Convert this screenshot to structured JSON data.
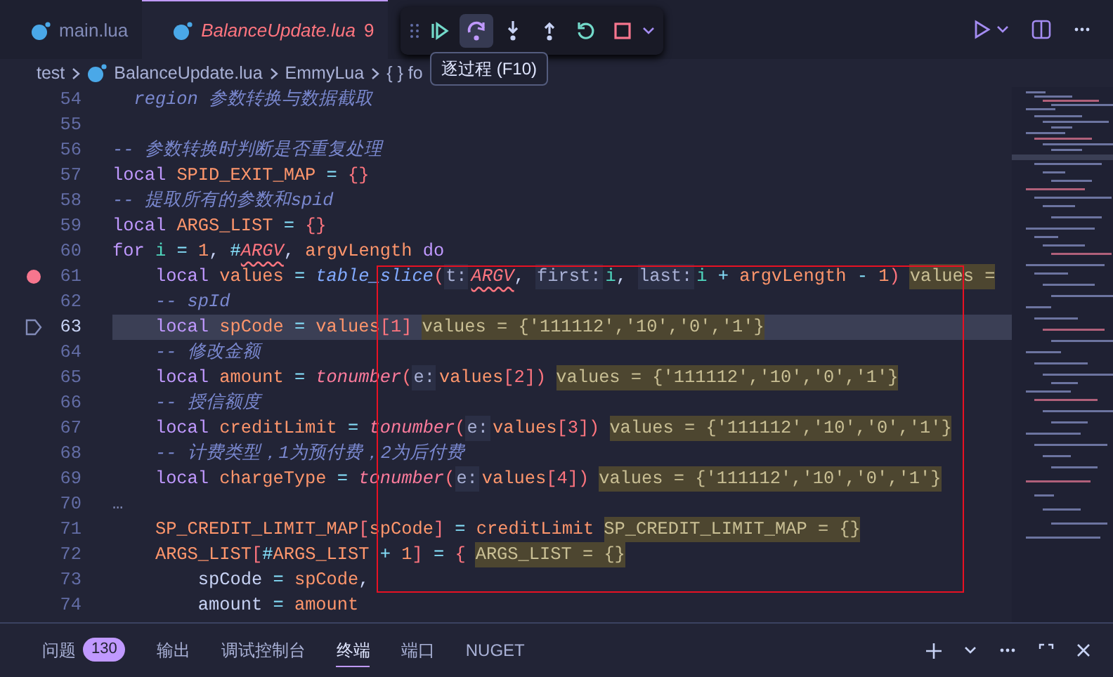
{
  "tabs": [
    {
      "label": "main.lua",
      "selected": false
    },
    {
      "label": "BalanceUpdate.lua",
      "selected": true,
      "problems": "9"
    }
  ],
  "debug_toolbar": {
    "buttons": [
      {
        "kind": "continue",
        "active": false
      },
      {
        "kind": "step-over",
        "active": true
      },
      {
        "kind": "step-into",
        "active": false
      },
      {
        "kind": "step-out",
        "active": false
      },
      {
        "kind": "restart",
        "active": false
      },
      {
        "kind": "stop",
        "active": false
      }
    ],
    "tooltip": "逐过程 (F10)"
  },
  "breadcrumb": [
    "test",
    "BalanceUpdate.lua",
    "EmmyLua",
    "{ } fo"
  ],
  "editor": {
    "lines": [
      {
        "number": "54",
        "breakpoint": false,
        "current": false,
        "tokens": [
          {
            "kind": "comment",
            "text": "  region 参数转换与数据截取"
          }
        ]
      },
      {
        "number": "55",
        "breakpoint": false,
        "current": false
      },
      {
        "number": "56",
        "breakpoint": false,
        "current": false,
        "tokens": [
          {
            "kind": "comment",
            "text": "-- 参数转换时判断是否重复处理"
          }
        ]
      },
      {
        "number": "57",
        "breakpoint": false,
        "current": false,
        "tokens": [
          {
            "kind": "kw",
            "text": "local "
          },
          {
            "kind": "var",
            "text": "SPID_EXIT_MAP "
          },
          {
            "kind": "op",
            "text": "= "
          },
          {
            "kind": "br",
            "text": "{}"
          }
        ]
      },
      {
        "number": "58",
        "breakpoint": false,
        "current": false,
        "tokens": [
          {
            "kind": "comment",
            "text": "-- 提取所有的参数和spid"
          }
        ]
      },
      {
        "number": "59",
        "breakpoint": false,
        "current": false,
        "tokens": [
          {
            "kind": "kw",
            "text": "local "
          },
          {
            "kind": "var",
            "text": "ARGS_LIST "
          },
          {
            "kind": "op",
            "text": "= "
          },
          {
            "kind": "br",
            "text": "{}"
          }
        ]
      },
      {
        "number": "60",
        "breakpoint": false,
        "current": false,
        "tokens": [
          {
            "kind": "kw",
            "text": "for "
          },
          {
            "kind": "loop",
            "text": "i "
          },
          {
            "kind": "op",
            "text": "= "
          },
          {
            "kind": "num",
            "text": "1"
          },
          {
            "kind": "plain",
            "text": ", "
          },
          {
            "kind": "op",
            "text": "#"
          },
          {
            "kind": "err",
            "text": "ARGV"
          },
          {
            "kind": "plain",
            "text": ", "
          },
          {
            "kind": "var",
            "text": "argvLength "
          },
          {
            "kind": "kw",
            "text": "do"
          }
        ]
      },
      {
        "number": "61",
        "breakpoint": true,
        "current": false,
        "tokens": [
          {
            "kind": "kw",
            "text": "    local "
          },
          {
            "kind": "var",
            "text": "values "
          },
          {
            "kind": "op",
            "text": "= "
          },
          {
            "kind": "fn",
            "text": "table_slice"
          },
          {
            "kind": "br",
            "text": "("
          },
          {
            "kind": "param",
            "text": "t:"
          },
          {
            "kind": "err",
            "text": "ARGV"
          },
          {
            "kind": "plain",
            "text": ", "
          },
          {
            "kind": "param",
            "text": "first:"
          },
          {
            "kind": "loop",
            "text": "i"
          },
          {
            "kind": "plain",
            "text": ", "
          },
          {
            "kind": "param",
            "text": "last:"
          },
          {
            "kind": "loop",
            "text": "i "
          },
          {
            "kind": "op",
            "text": "+ "
          },
          {
            "kind": "var",
            "text": "argvLength "
          },
          {
            "kind": "op",
            "text": "- "
          },
          {
            "kind": "num",
            "text": "1"
          },
          {
            "kind": "br",
            "text": ")"
          },
          {
            "kind": "inline",
            "text": "values ="
          }
        ]
      },
      {
        "number": "62",
        "breakpoint": false,
        "current": false,
        "tokens": [
          {
            "kind": "comment",
            "text": "    -- spId"
          }
        ]
      },
      {
        "number": "63",
        "breakpoint": false,
        "current": true,
        "tokens": [
          {
            "kind": "kw",
            "text": "    local "
          },
          {
            "kind": "var",
            "text": "spCode "
          },
          {
            "kind": "op",
            "text": "= "
          },
          {
            "kind": "var",
            "text": "values"
          },
          {
            "kind": "br",
            "text": "[1]"
          },
          {
            "kind": "inline",
            "text": "values = {'111112','10','0','1'}"
          }
        ]
      },
      {
        "number": "64",
        "breakpoint": false,
        "current": false,
        "tokens": [
          {
            "kind": "comment",
            "text": "    -- 修改金额"
          }
        ]
      },
      {
        "number": "65",
        "breakpoint": false,
        "current": false,
        "tokens": [
          {
            "kind": "kw",
            "text": "    local "
          },
          {
            "kind": "var",
            "text": "amount "
          },
          {
            "kind": "op",
            "text": "= "
          },
          {
            "kind": "builtin",
            "text": "tonumber"
          },
          {
            "kind": "br",
            "text": "("
          },
          {
            "kind": "param",
            "text": "e:"
          },
          {
            "kind": "var",
            "text": "values"
          },
          {
            "kind": "br",
            "text": "[2])"
          },
          {
            "kind": "inline",
            "text": "values = {'111112','10','0','1'}"
          }
        ]
      },
      {
        "number": "66",
        "breakpoint": false,
        "current": false,
        "tokens": [
          {
            "kind": "comment",
            "text": "    -- 授信额度"
          }
        ]
      },
      {
        "number": "67",
        "breakpoint": false,
        "current": false,
        "tokens": [
          {
            "kind": "kw",
            "text": "    local "
          },
          {
            "kind": "var",
            "text": "creditLimit "
          },
          {
            "kind": "op",
            "text": "= "
          },
          {
            "kind": "builtin",
            "text": "tonumber"
          },
          {
            "kind": "br",
            "text": "("
          },
          {
            "kind": "param",
            "text": "e:"
          },
          {
            "kind": "var",
            "text": "values"
          },
          {
            "kind": "br",
            "text": "[3])"
          },
          {
            "kind": "inline",
            "text": "values = {'111112','10','0','1'}"
          }
        ]
      },
      {
        "number": "68",
        "breakpoint": false,
        "current": false,
        "tokens": [
          {
            "kind": "comment",
            "text": "    -- 计费类型，1为预付费，2为后付费"
          }
        ]
      },
      {
        "number": "69",
        "breakpoint": false,
        "current": false,
        "tokens": [
          {
            "kind": "kw",
            "text": "    local "
          },
          {
            "kind": "var",
            "text": "chargeType "
          },
          {
            "kind": "op",
            "text": "= "
          },
          {
            "kind": "builtin",
            "text": "tonumber"
          },
          {
            "kind": "br",
            "text": "("
          },
          {
            "kind": "param",
            "text": "e:"
          },
          {
            "kind": "var",
            "text": "values"
          },
          {
            "kind": "br",
            "text": "[4])"
          },
          {
            "kind": "inline",
            "text": "values = {'111112','10','0','1'}"
          }
        ]
      },
      {
        "number": "70",
        "breakpoint": false,
        "current": false,
        "tokens": [
          {
            "kind": "fold",
            "text": "…"
          }
        ]
      },
      {
        "number": "71",
        "breakpoint": false,
        "current": false,
        "tokens": [
          {
            "kind": "var",
            "text": "    SP_CREDIT_LIMIT_MAP"
          },
          {
            "kind": "br",
            "text": "["
          },
          {
            "kind": "var",
            "text": "spCode"
          },
          {
            "kind": "br",
            "text": "] "
          },
          {
            "kind": "op",
            "text": "= "
          },
          {
            "kind": "var",
            "text": "creditLimit"
          },
          {
            "kind": "inline",
            "text": "SP_CREDIT_LIMIT_MAP = {}"
          }
        ]
      },
      {
        "number": "72",
        "breakpoint": false,
        "current": false,
        "tokens": [
          {
            "kind": "var",
            "text": "    ARGS_LIST"
          },
          {
            "kind": "br",
            "text": "["
          },
          {
            "kind": "op",
            "text": "#"
          },
          {
            "kind": "var",
            "text": "ARGS_LIST "
          },
          {
            "kind": "op",
            "text": "+ "
          },
          {
            "kind": "num",
            "text": "1"
          },
          {
            "kind": "br",
            "text": "] "
          },
          {
            "kind": "op",
            "text": "= "
          },
          {
            "kind": "br",
            "text": "{"
          },
          {
            "kind": "inline",
            "text": "ARGS_LIST = {}"
          }
        ]
      },
      {
        "number": "73",
        "breakpoint": false,
        "current": false,
        "tokens": [
          {
            "kind": "plain",
            "text": "        spCode "
          },
          {
            "kind": "op",
            "text": "= "
          },
          {
            "kind": "var",
            "text": "spCode"
          },
          {
            "kind": "plain",
            "text": ","
          }
        ]
      },
      {
        "number": "74",
        "breakpoint": false,
        "current": false,
        "tokens": [
          {
            "kind": "plain",
            "text": "        amount "
          },
          {
            "kind": "op",
            "text": "= "
          },
          {
            "kind": "var",
            "text": "amount"
          }
        ]
      }
    ]
  },
  "panel": {
    "tabs": [
      {
        "label": "问题",
        "badge": "130",
        "selected": false
      },
      {
        "label": "输出",
        "selected": false
      },
      {
        "label": "调试控制台",
        "selected": false
      },
      {
        "label": "终端",
        "selected": true
      },
      {
        "label": "端口",
        "selected": false
      },
      {
        "label": "NUGET",
        "selected": false
      }
    ]
  }
}
